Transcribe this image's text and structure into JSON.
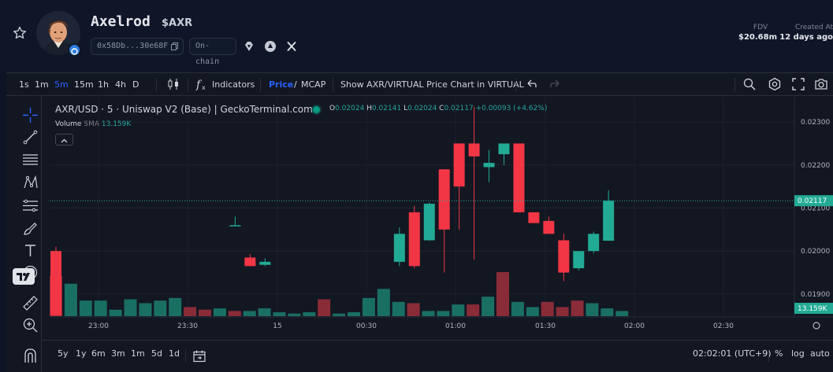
{
  "token": {
    "name": "Axelrod",
    "symbol": "$AXR",
    "address_short": "0x58Db...30e68F",
    "chain_label": "On-chain",
    "fdv_label": "FDV",
    "fdv_value": "$20.68m",
    "created_label": "Created At",
    "created_value": "12 days ago"
  },
  "toolbar": {
    "intervals": [
      "1s",
      "1m",
      "5m",
      "15m",
      "1h",
      "4h",
      "D"
    ],
    "active_interval": "5m",
    "indicators_label": "Indicators",
    "price_label": "Price",
    "price_sep": "/",
    "mcap_label": "MCAP",
    "show_pair_label": "Show AXR/VIRTUAL Price Chart in VIRTUAL"
  },
  "legend": {
    "title": "AXR/USD · 5 · Uniswap V2 (Base) | GeckoTerminal.com",
    "o_label": "O",
    "o_value": "0.02024",
    "h_label": "H",
    "h_value": "0.02141",
    "l_label": "L",
    "l_value": "0.02024",
    "c_label": "C",
    "c_value": "0.02117",
    "change": "+0.00093 (+4.62%)",
    "volume_label": "Volume",
    "sma_label": "SMA",
    "volume_value": "13.159K"
  },
  "bottom": {
    "ranges": [
      "5y",
      "1y",
      "6m",
      "3m",
      "1m",
      "5d",
      "1d"
    ],
    "time": "02:02:01 (UTC+9)",
    "percent_label": "%",
    "log_label": "log",
    "auto_label": "auto"
  },
  "colors": {
    "up": "#22ab94",
    "down": "#f23645",
    "up_volume": "#1a6f63",
    "down_volume": "#8a2c38",
    "price_tag": "#22ab94",
    "background": "#131722"
  },
  "chart_data": {
    "type": "candlestick",
    "title": "AXR/USD · 5 · Uniswap V2 (Base) | GeckoTerminal.com",
    "x_ticks": [
      "23:00",
      "23:30",
      "15",
      "00:30",
      "01:00",
      "01:30",
      "02:00",
      "02:30"
    ],
    "y_ticks": [
      "0.02300",
      "0.02200",
      "0.02100",
      "0.02000",
      "0.01900"
    ],
    "ylim": [
      0.01845,
      0.02355
    ],
    "last_price_label": "0.02117",
    "last_volume_label": "13.159K",
    "candles": [
      {
        "o": 0.02,
        "h": 0.0201,
        "l": 0.0185,
        "c": 0.0185
      },
      {
        "o": 0.0206,
        "h": 0.0208,
        "l": 0.0206,
        "c": 0.0206
      },
      {
        "o": 0.01985,
        "h": 0.01993,
        "l": 0.01965,
        "c": 0.01965
      },
      {
        "o": 0.01968,
        "h": 0.01983,
        "l": 0.01965,
        "c": 0.01975
      },
      {
        "o": 0.01975,
        "h": 0.02055,
        "l": 0.01965,
        "c": 0.0204
      },
      {
        "o": 0.0209,
        "h": 0.02105,
        "l": 0.0196,
        "c": 0.01965
      },
      {
        "o": 0.02025,
        "h": 0.02113,
        "l": 0.02024,
        "c": 0.0211
      },
      {
        "o": 0.0219,
        "h": 0.0219,
        "l": 0.0195,
        "c": 0.0205
      },
      {
        "o": 0.0225,
        "h": 0.0225,
        "l": 0.0205,
        "c": 0.0215
      },
      {
        "o": 0.0225,
        "h": 0.02335,
        "l": 0.0198,
        "c": 0.0222
      },
      {
        "o": 0.02195,
        "h": 0.02235,
        "l": 0.0216,
        "c": 0.02205
      },
      {
        "o": 0.02225,
        "h": 0.0225,
        "l": 0.022,
        "c": 0.0225
      },
      {
        "o": 0.0225,
        "h": 0.0225,
        "l": 0.0209,
        "c": 0.0209
      },
      {
        "o": 0.0209,
        "h": 0.0209,
        "l": 0.02065,
        "c": 0.02065
      },
      {
        "o": 0.0207,
        "h": 0.0208,
        "l": 0.0204,
        "c": 0.0204
      },
      {
        "o": 0.02025,
        "h": 0.0204,
        "l": 0.0193,
        "c": 0.0195
      },
      {
        "o": 0.0196,
        "h": 0.02,
        "l": 0.01955,
        "c": 0.02
      },
      {
        "o": 0.02,
        "h": 0.02045,
        "l": 0.01995,
        "c": 0.0204
      },
      {
        "o": 0.02024,
        "h": 0.02141,
        "l": 0.02024,
        "c": 0.02117
      }
    ],
    "volume": [
      {
        "t": 0,
        "v": 31,
        "up": false
      },
      {
        "t": 1,
        "v": 25,
        "up": true
      },
      {
        "t": 2,
        "v": 12,
        "up": true
      },
      {
        "t": 3,
        "v": 12,
        "up": true
      },
      {
        "t": 4,
        "v": 5,
        "up": true
      },
      {
        "t": 5,
        "v": 13,
        "up": true
      },
      {
        "t": 6,
        "v": 10,
        "up": true
      },
      {
        "t": 7,
        "v": 12,
        "up": true
      },
      {
        "t": 8,
        "v": 14,
        "up": true
      },
      {
        "t": 9,
        "v": 7,
        "up": false
      },
      {
        "t": 10,
        "v": 5,
        "up": false
      },
      {
        "t": 11,
        "v": 6,
        "up": true
      },
      {
        "t": 12,
        "v": 4,
        "up": false
      },
      {
        "t": 13,
        "v": 4,
        "up": true
      },
      {
        "t": 14,
        "v": 6,
        "up": true
      },
      {
        "t": 15,
        "v": 3,
        "up": true
      },
      {
        "t": 16,
        "v": 2,
        "up": true
      },
      {
        "t": 17,
        "v": 3,
        "up": true
      },
      {
        "t": 18,
        "v": 13,
        "up": false
      },
      {
        "t": 19,
        "v": 2,
        "up": true
      },
      {
        "t": 20,
        "v": 3,
        "up": true
      },
      {
        "t": 21,
        "v": 14,
        "up": true
      },
      {
        "t": 22,
        "v": 21,
        "up": true
      },
      {
        "t": 23,
        "v": 11,
        "up": true
      },
      {
        "t": 24,
        "v": 10,
        "up": false
      },
      {
        "t": 25,
        "v": 4,
        "up": true
      },
      {
        "t": 26,
        "v": 4,
        "up": true
      },
      {
        "t": 27,
        "v": 9,
        "up": true
      },
      {
        "t": 28,
        "v": 9,
        "up": false
      },
      {
        "t": 29,
        "v": 15,
        "up": true
      },
      {
        "t": 30,
        "v": 34,
        "up": false
      },
      {
        "t": 31,
        "v": 11,
        "up": true
      },
      {
        "t": 32,
        "v": 7,
        "up": true
      },
      {
        "t": 33,
        "v": 11,
        "up": false
      },
      {
        "t": 34,
        "v": 7,
        "up": false
      },
      {
        "t": 35,
        "v": 12,
        "up": false
      },
      {
        "t": 36,
        "v": 10,
        "up": true
      },
      {
        "t": 37,
        "v": 6,
        "up": true
      },
      {
        "t": 38,
        "v": 4,
        "up": true
      }
    ]
  }
}
